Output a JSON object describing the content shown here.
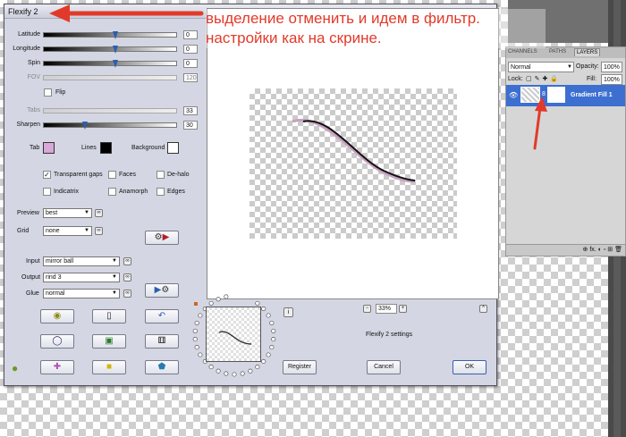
{
  "dialog": {
    "title": "Flexify 2",
    "sliders": [
      {
        "label": "Latitude",
        "value": "0",
        "fill": 0.53,
        "enabled": true
      },
      {
        "label": "Longitude",
        "value": "0",
        "fill": 0.53,
        "enabled": true
      },
      {
        "label": "Spin",
        "value": "0",
        "fill": 0.53,
        "enabled": true
      },
      {
        "label": "FOV",
        "value": "120",
        "fill": 0,
        "enabled": false
      },
      {
        "label": "Tabs",
        "value": "33",
        "fill": 0,
        "enabled": false
      },
      {
        "label": "Sharpen",
        "value": "30",
        "fill": 0.3,
        "enabled": true
      }
    ],
    "flip_label": "Flip",
    "colors": {
      "tab_label": "Tab",
      "tab_color": "#d8a8d8",
      "lines_label": "Lines",
      "lines_color": "#000000",
      "background_label": "Background",
      "background_color": "#ffffff"
    },
    "checkboxes": [
      {
        "label": "Transparent gaps",
        "checked": true
      },
      {
        "label": "Faces",
        "checked": false
      },
      {
        "label": "De-halo",
        "checked": false
      },
      {
        "label": "Indicatrix",
        "checked": false
      },
      {
        "label": "Anamorph",
        "checked": false
      },
      {
        "label": "Edges",
        "checked": false
      }
    ],
    "preview_label": "Preview",
    "preview_value": "best",
    "grid_label": "Grid",
    "grid_value": "none",
    "input_label": "Input",
    "input_value": "mirror ball",
    "output_label": "Output",
    "output_value": "rind 3",
    "glue_label": "Glue",
    "glue_value": "normal",
    "zoom": "33%",
    "zoom_minus": "−",
    "zoom_plus": "+",
    "info_icon": "i",
    "up_icon": "^",
    "settings_text": "Flexify 2 settings",
    "register_label": "Register",
    "cancel_label": "Cancel",
    "ok_label": "OK"
  },
  "annotation": {
    "line1": "выделение отменить и идем в фильтр.",
    "line2": "настройки как на скрине."
  },
  "layers_panel": {
    "tab_channels": "CHANNELS",
    "tab_paths": "PATHS",
    "tab_layers": "LAYERS",
    "blend_mode": "Normal",
    "opacity_label": "Opacity:",
    "opacity_value": "100%",
    "lock_label": "Lock:",
    "fill_label": "Fill:",
    "fill_value": "100%",
    "layer_name": "Gradient Fill 1",
    "footer_icons": "⊕  fx.  ◐  ▫  ⊞  🗑"
  }
}
